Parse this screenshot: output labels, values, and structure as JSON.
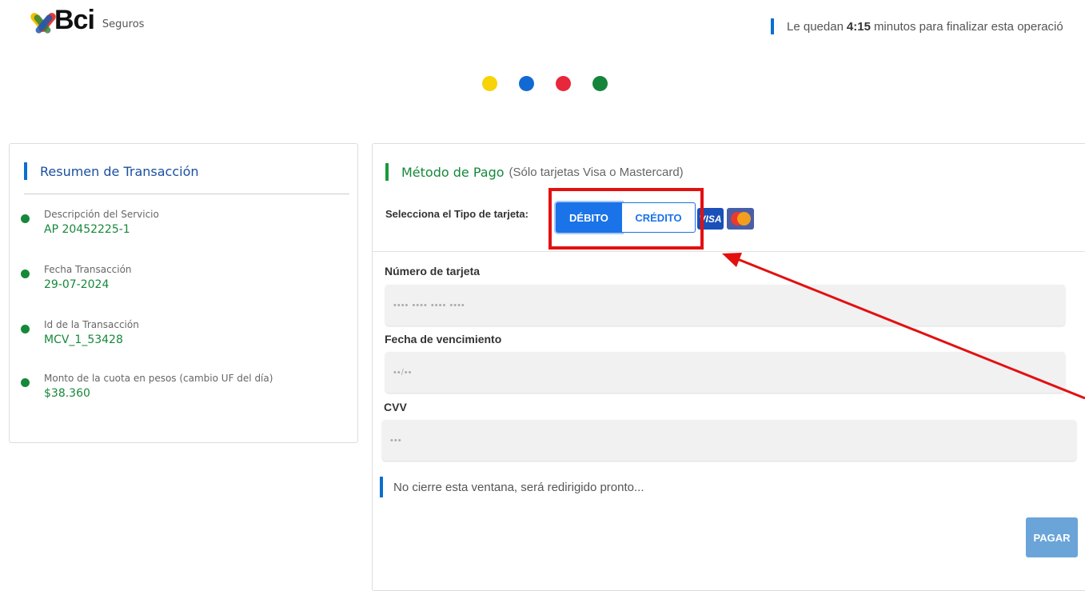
{
  "header": {
    "brand": "Bci",
    "brand_sub": "Seguros",
    "timer_prefix": "Le quedan",
    "timer_value": "4:15",
    "timer_suffix": "minutos para finalizar esta operació"
  },
  "steps": {
    "colors": [
      "#f7d308",
      "#1269d3",
      "#e8273b",
      "#17843c"
    ]
  },
  "summary": {
    "title": "Resumen de Transacción",
    "items": [
      {
        "label": "Descripción del Servicio",
        "value": "AP 20452225-1"
      },
      {
        "label": "Fecha Transacción",
        "value": "29-07-2024"
      },
      {
        "label": "Id de la Transacción",
        "value": "MCV_1_53428"
      },
      {
        "label": "Monto de la cuota en pesos (cambio UF del día)",
        "value": "$38.360"
      }
    ]
  },
  "payment": {
    "title": "Método de Pago",
    "subtitle": "(Sólo tarjetas Visa o Mastercard)",
    "card_type_label": "Selecciona el Tipo de tarjeta:",
    "debit_label": "DÉBITO",
    "credit_label": "CRÉDITO",
    "selected": "DÉBITO",
    "visa_label": "VISA",
    "card_number_label": "Número de tarjeta",
    "card_number_placeholder": "•••• •••• •••• ••••",
    "expiry_label": "Fecha de vencimiento",
    "expiry_placeholder": "••/••",
    "cvv_label": "CVV",
    "cvv_placeholder": "•••",
    "notice": "No cierre esta ventana, será redirigido pronto...",
    "pay_button": "PAGAR"
  },
  "colors": {
    "accent_blue": "#0a6fd1",
    "accent_green": "#16883a",
    "button_blue": "#1a73e8",
    "highlight_red": "#e31010"
  }
}
